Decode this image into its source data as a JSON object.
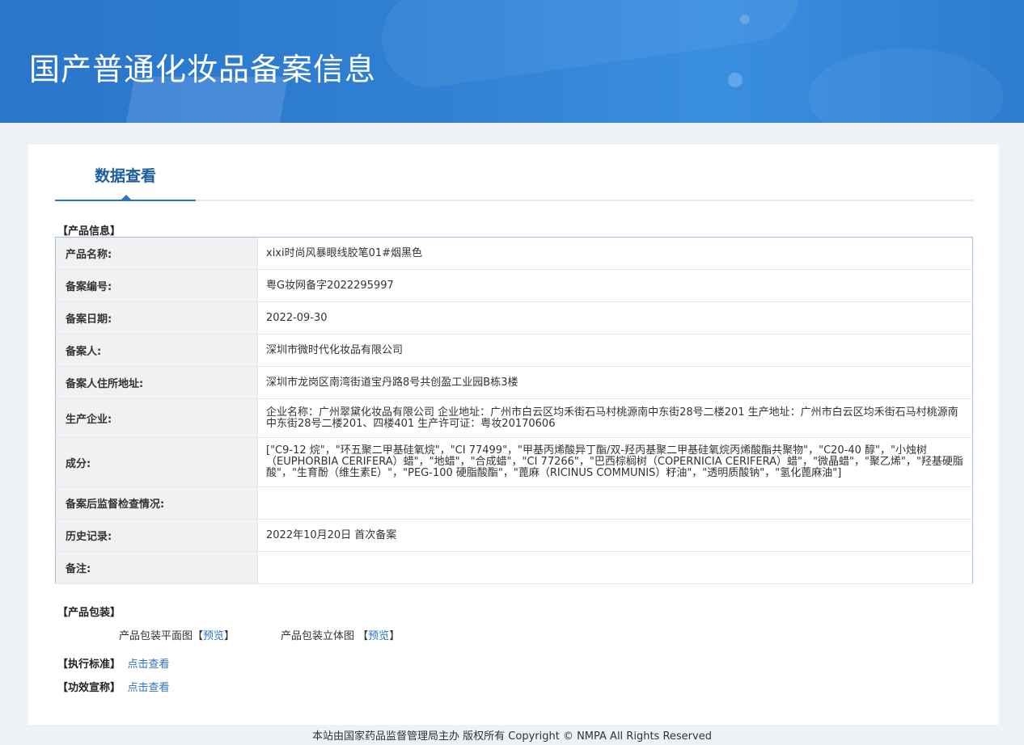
{
  "header": {
    "title": "国产普通化妆品备案信息"
  },
  "tabs": [
    {
      "label": "数据查看"
    }
  ],
  "sections": {
    "product_info": "【产品信息】",
    "packaging": "【产品包装】",
    "standard": "【执行标准】",
    "efficacy": "【功效宣称】"
  },
  "product_info": {
    "rows": [
      {
        "key": "产品名称:",
        "value": "xixi时尚风暴眼线胶笔01#烟黑色"
      },
      {
        "key": "备案编号:",
        "value": "粤G妆网备字2022295997"
      },
      {
        "key": "备案日期:",
        "value": "2022-09-30"
      },
      {
        "key": "备案人:",
        "value": "深圳市微时代化妆品有限公司"
      },
      {
        "key": "备案人住所地址:",
        "value": "深圳市龙岗区南湾街道宝丹路8号共创盈工业园B栋3楼"
      },
      {
        "key": "生产企业:",
        "value": "企业名称：广州翠黛化妆品有限公司 企业地址：广州市白云区均禾街石马村桃源南中东街28号二楼201 生产地址：广州市白云区均禾街石马村桃源南中东街28号二楼201、四楼401 生产许可证：粤妆20170606"
      },
      {
        "key": "成分:",
        "value": "[\"C9-12 烷\"，\"环五聚二甲基硅氧烷\"，\"CI 77499\"，\"甲基丙烯酸异丁酯/双-羟丙基聚二甲基硅氧烷丙烯酸酯共聚物\"，\"C20-40 醇\"，\"小烛树（EUPHORBIA CERIFERA）蜡\"，\"地蜡\"，\"合成蜡\"，\"CI 77266\"，\"巴西棕榈树（COPERNICIA CERIFERA）蜡\"，\"微晶蜡\"，\"聚乙烯\"，\"羟基硬脂酸\"，\"生育酚（维生素E）\"，\"PEG-100 硬脂酸酯\"，\"蓖麻（RICINUS COMMUNIS）籽油\"，\"透明质酸钠\"，\"氢化蓖麻油\"]"
      },
      {
        "key": "备案后监督检查情况:",
        "value": ""
      },
      {
        "key": "历史记录:",
        "value": "2022年10月20日 首次备案"
      },
      {
        "key": "备注:",
        "value": ""
      }
    ]
  },
  "packaging": {
    "flat_label": "产品包装平面图",
    "solid_label": "产品包装立体图",
    "bracket_open": "【",
    "bracket_close": "】",
    "preview_link": "预览"
  },
  "links": {
    "view": "点击查看"
  },
  "footer": {
    "text": "本站由国家药品监督管理局主办 版权所有 Copyright © NMPA All Rights Reserved"
  },
  "colors": {
    "banner": "#2f7fd3",
    "accent": "#2c73c4",
    "tab_text": "#1f5e9c"
  }
}
